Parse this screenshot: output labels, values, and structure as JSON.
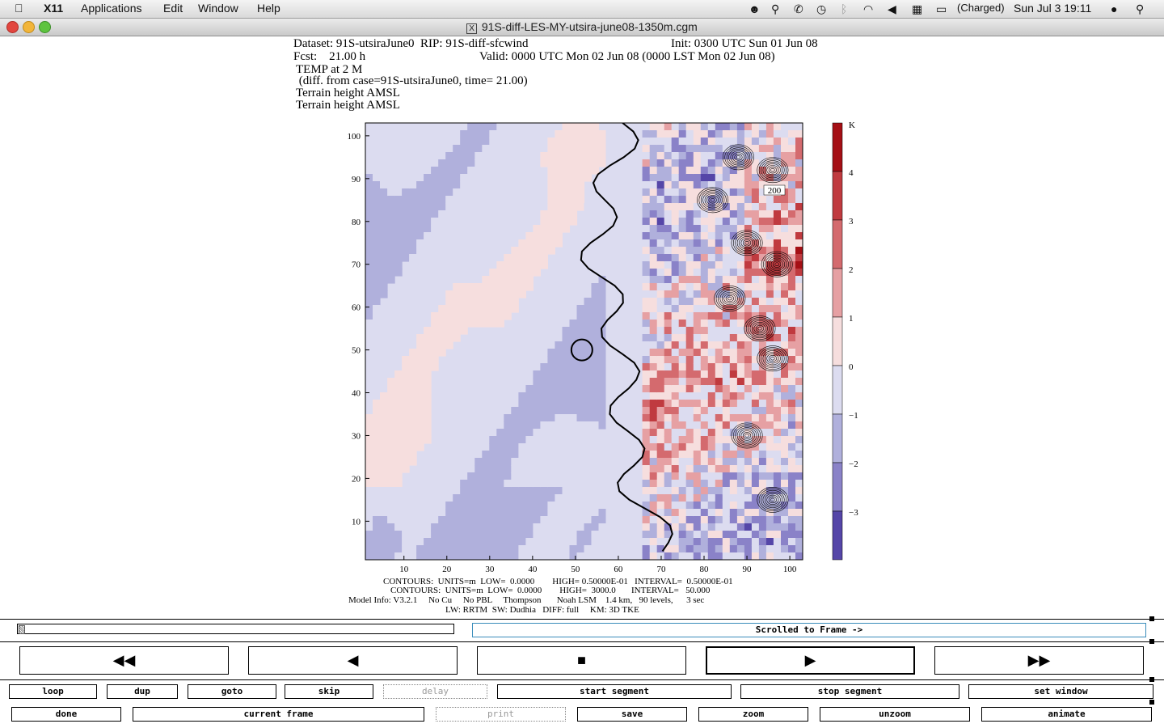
{
  "menubar": {
    "app": "X11",
    "items": [
      "Applications",
      "Edit",
      "Window",
      "Help"
    ],
    "battery": "(Charged)",
    "clock": "Sun Jul 3  19:11"
  },
  "window": {
    "title": "91S-diff-LES-MY-utsira-june08-1350m.cgm"
  },
  "plot_header": {
    "line1_left": "Dataset: 91S-utsiraJune0  RIP: 91S-diff-sfcwind",
    "line1_right": "Init: 0300 UTC Sun 01 Jun 08",
    "line2_left": "Fcst:    21.00 h",
    "line2_right": "Valid: 0000 UTC Mon 02 Jun 08 (0000 LST Mon 02 Jun 08)",
    "line3": "TEMP at 2 M",
    "line4": " (diff. from case=91S-utsiraJune0, time= 21.00)",
    "line5": "Terrain height AMSL",
    "line6": "Terrain height AMSL"
  },
  "chart_data": {
    "type": "heatmap",
    "x_ticks": [
      10,
      20,
      30,
      40,
      50,
      60,
      70,
      80,
      90,
      100
    ],
    "y_ticks": [
      10,
      20,
      30,
      40,
      50,
      60,
      70,
      80,
      90,
      100
    ],
    "xlim": [
      1,
      103
    ],
    "ylim": [
      1,
      103
    ],
    "colorbar": {
      "unit": "K",
      "labels": [
        "4",
        "3",
        "2",
        "1",
        "0",
        "−1",
        "−2",
        "−3"
      ],
      "colors": [
        "#a50f15",
        "#c03a3f",
        "#d46a6e",
        "#e6a0a3",
        "#f6dede",
        "#dcdcf0",
        "#b0b0dc",
        "#8a82c8",
        "#5546a8"
      ]
    },
    "contour_label": "200"
  },
  "footer": {
    "l1": "CONTOURS:  UNITS=m  LOW=  0.0000        HIGH= 0.50000E-01   INTERVAL=  0.50000E-01",
    "l2": "CONTOURS:  UNITS=m  LOW=  0.0000        HIGH=  3000.0       INTERVAL=   50.000",
    "l3": "Model Info: V3.2.1     No Cu     No PBL     Thompson       Noah LSM    1.4 km,   90 levels,      3 sec",
    "l4": "LW: RRTM  SW: Dudhia   DIFF: full     KM: 3D TKE"
  },
  "controls": {
    "status": "Scrolled to Frame ->",
    "nav": {
      "rewind": "◀◀",
      "back": "◀",
      "stop": "■",
      "play": "▶",
      "fastforward": "▶▶"
    },
    "row1": [
      "loop",
      "dup",
      "goto",
      "skip",
      "delay",
      "start segment",
      "stop segment",
      "set window"
    ],
    "row2": [
      "done",
      "current frame",
      "print",
      "save",
      "zoom",
      "unzoom",
      "animate"
    ]
  }
}
